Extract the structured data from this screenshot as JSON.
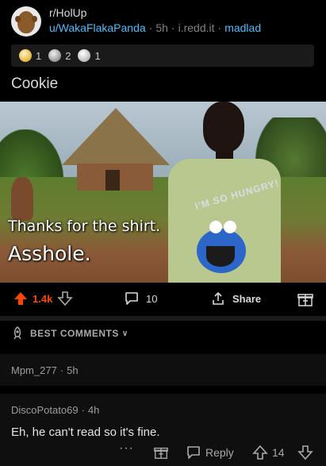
{
  "post": {
    "subreddit": "r/HolUp",
    "user": "u/WakaFlakaPanda",
    "age": "5h",
    "domain": "i.redd.it",
    "flair": "madlad",
    "title": "Cookie"
  },
  "awards": [
    {
      "icon": "silver-award-icon",
      "count": "1"
    },
    {
      "icon": "helpful-hands-award-icon",
      "count": "2"
    },
    {
      "icon": "wholesome-award-icon",
      "count": "1"
    }
  ],
  "image": {
    "caption_line1": "Thanks for the shirt.",
    "caption_line2": "Asshole.",
    "shirt_text": "I'M SO HUNGRY!"
  },
  "actions": {
    "upvotes": "1.4k",
    "comments": "10",
    "share_label": "Share"
  },
  "sort": {
    "label": "BEST COMMENTS"
  },
  "comments": [
    {
      "author": "Mpm_277",
      "age": "5h",
      "body": ""
    },
    {
      "author": "DiscoPotato69",
      "age": "4h",
      "body": "Eh, he can't read so it's fine.",
      "reply_label": "Reply",
      "score": "14"
    }
  ],
  "colors": {
    "background": "#000000",
    "accent_upvote": "#ff4500",
    "link_blue": "#4fbcff",
    "panel": "#1a1a1b"
  }
}
